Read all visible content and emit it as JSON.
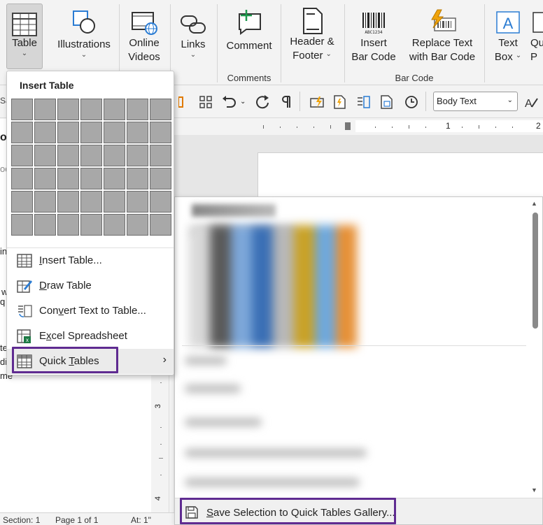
{
  "ribbon": {
    "buttons": [
      {
        "label": "Table",
        "dropdown": true
      },
      {
        "label": "Illustrations",
        "dropdown": true
      },
      {
        "label": "Online Videos",
        "line1": "Online",
        "line2": "Videos"
      },
      {
        "label": "Links",
        "dropdown": true
      },
      {
        "label": "Comment"
      },
      {
        "label": "Header & Footer",
        "line1": "Header &",
        "line2": "Footer"
      },
      {
        "label": "Insert Bar Code",
        "line1": "Insert",
        "line2": "Bar Code"
      },
      {
        "label": "Replace Text with Bar Code",
        "line1": "Replace Text",
        "line2": "with Bar Code"
      },
      {
        "label": "Text Box",
        "line1": "Text",
        "line2": "Box"
      },
      {
        "label": "Qu",
        "line1": "Qu",
        "line2": "P"
      }
    ],
    "groups": {
      "comments": "Comments",
      "barcode": "Bar Code"
    },
    "barcode_caption": "ABC1234"
  },
  "toolbar": {
    "style_value": "Body Text",
    "left_fragments": [
      "Sa",
      "o",
      "od"
    ]
  },
  "ruler": {
    "marks": [
      "1",
      "2"
    ]
  },
  "vruler": {
    "marks": [
      "3",
      "4"
    ]
  },
  "left_doc": {
    "fragments": [
      "in",
      "w",
      "q",
      "te",
      "di",
      "me"
    ]
  },
  "menu": {
    "title": "Insert Table",
    "grid": {
      "rows": 6,
      "cols": 7
    },
    "items": [
      {
        "pre": "",
        "u": "I",
        "post": "nsert Table...",
        "icon": "insert-table-icon"
      },
      {
        "pre": "",
        "u": "D",
        "post": "raw Table",
        "icon": "draw-table-icon"
      },
      {
        "pre": "Con",
        "u": "v",
        "post": "ert Text to Table...",
        "icon": "convert-text-icon"
      },
      {
        "pre": "E",
        "u": "x",
        "post": "cel Spreadsheet",
        "icon": "excel-icon"
      },
      {
        "pre": "Quick ",
        "u": "T",
        "post": "ables",
        "icon": "quick-tables-icon"
      }
    ]
  },
  "gallery": {
    "save_label": "Save Selection to Quick Tables Gallery...",
    "save_underline": "S",
    "save_rest": "ave Selection to Quick Tables Gallery...",
    "thumb_colors": [
      "#d9d9d9",
      "#5a5a5a",
      "#7da7d9",
      "#3a6fb5",
      "#b8b8b8",
      "#c9a227",
      "#6fa8dc",
      "#e69138"
    ]
  },
  "status": {
    "section": "Section: 1",
    "page": "Page 1 of 1",
    "at": "At: 1\""
  },
  "colors": {
    "highlight_outline": "#5f2b91",
    "accent_blue": "#2b7cd3",
    "excel_green": "#1d7a45"
  }
}
